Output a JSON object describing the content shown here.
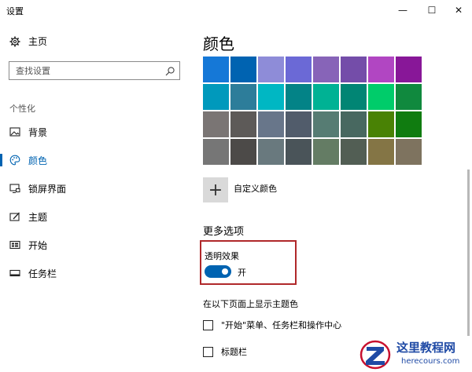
{
  "window": {
    "title": "设置",
    "minimize_glyph": "—",
    "maximize_glyph": "☐",
    "close_glyph": "✕"
  },
  "sidebar": {
    "home": {
      "label": "主页",
      "icon": "gear-icon"
    },
    "search": {
      "placeholder": "查找设置",
      "icon": "search-icon"
    },
    "section_label": "个性化",
    "items": [
      {
        "label": "背景",
        "icon": "picture-icon",
        "active": false
      },
      {
        "label": "颜色",
        "icon": "palette-icon",
        "active": true
      },
      {
        "label": "锁屏界面",
        "icon": "lock-screen-icon",
        "active": false
      },
      {
        "label": "主题",
        "icon": "theme-icon",
        "active": false
      },
      {
        "label": "开始",
        "icon": "start-icon",
        "active": false
      },
      {
        "label": "任务栏",
        "icon": "taskbar-icon",
        "active": false
      }
    ]
  },
  "content": {
    "heading": "颜色",
    "swatches": [
      "#1578d7",
      "#0063b1",
      "#8e8cd8",
      "#6b69d6",
      "#8764b8",
      "#744da9",
      "#b146c2",
      "#881798",
      "#0099bc",
      "#2d7d9a",
      "#00b7c3",
      "#038387",
      "#00b294",
      "#018574",
      "#00cc6a",
      "#10893e",
      "#7a7574",
      "#5d5a58",
      "#68768a",
      "#515c6b",
      "#567c73",
      "#486860",
      "#498205",
      "#107c10",
      "#767676",
      "#4c4a48",
      "#69797e",
      "#4a5459",
      "#647c64",
      "#525e54",
      "#847545",
      "#7e735f"
    ],
    "custom_color": {
      "label": "自定义颜色",
      "glyph": "+"
    },
    "more_options": {
      "heading": "更多选项",
      "transparency_label": "透明效果",
      "transparency_state": "开",
      "transparency_on": true
    },
    "theme_color_heading": "在以下页面上显示主题色",
    "checkboxes": [
      {
        "label": "\"开始\"菜单、任务栏和操作中心",
        "checked": false
      },
      {
        "label": "标题栏",
        "checked": false
      }
    ]
  },
  "colors": {
    "accent": "#0063b1",
    "highlight_border": "#b0282a"
  },
  "watermark": {
    "text": "这里教程网",
    "domain": "herecours.com"
  }
}
